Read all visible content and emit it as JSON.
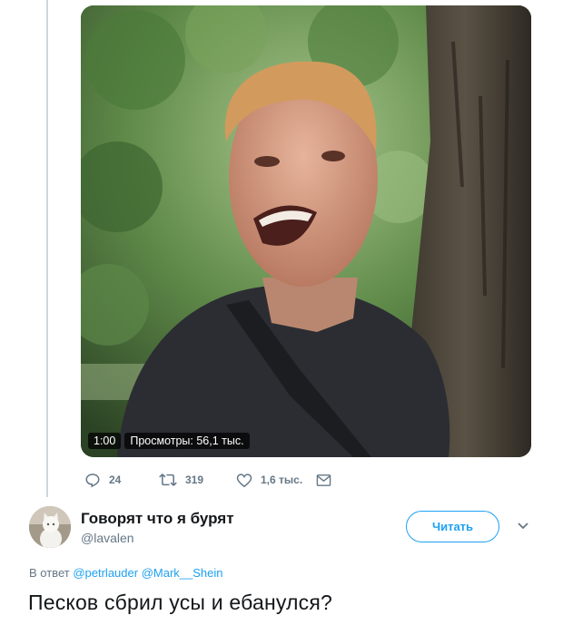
{
  "video": {
    "duration": "1:00",
    "views": "Просмотры: 56,1 тыс."
  },
  "actions": {
    "replies": "24",
    "retweets": "319",
    "likes": "1,6 тыс.",
    "icons": [
      "reply-icon",
      "retweet-icon",
      "like-icon",
      "dm-icon"
    ]
  },
  "tweet": {
    "display_name": "Говорят что я бурят",
    "handle": "@lavalen",
    "follow_label": "Читать",
    "reply_prefix": "В ответ",
    "mention1": "@petrlauder",
    "mention2": "@Mark__Shein",
    "text": "Песков сбрил усы и ебанулся?"
  },
  "colors": {
    "accent": "#1da1f2",
    "secondary_text": "#657786",
    "primary_text": "#14171a"
  }
}
